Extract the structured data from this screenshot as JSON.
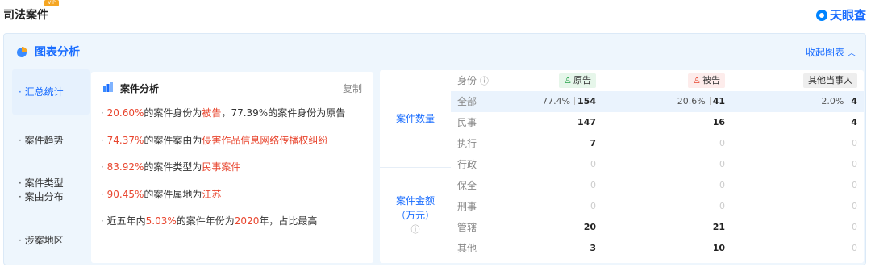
{
  "page": {
    "title": "司法案件",
    "badge": "VIP",
    "brand": "天眼查"
  },
  "panel": {
    "title": "图表分析",
    "collapse_label": "收起图表"
  },
  "nav": [
    {
      "label": "汇总统计"
    },
    {
      "label": "案件趋势"
    },
    {
      "label": "案件类型"
    },
    {
      "label": "案由分布"
    },
    {
      "label": "涉案地区"
    }
  ],
  "analysis": {
    "title": "案件分析",
    "copy_label": "复制",
    "lines": [
      {
        "a": "20.60%",
        "b": "的案件身份为",
        "c": "被告",
        "d": "，77.39%的案件身份为原告"
      },
      {
        "a": "74.37%",
        "b": "的案件案由为",
        "c": "侵害作品信息网络传播权纠纷",
        "d": ""
      },
      {
        "a": "83.92%",
        "b": "的案件类型为",
        "c": "民事案件",
        "d": ""
      },
      {
        "a": "90.45%",
        "b": "的案件属地为",
        "c": "江苏",
        "d": ""
      },
      {
        "pre": "近五年内",
        "a": "5.03%",
        "b": "的案件年份为",
        "c": "2020",
        "d": "年，占比最高"
      }
    ]
  },
  "stats": {
    "row_group_1": "案件数量",
    "row_group_2_line1": "案件金额",
    "row_group_2_line2": "（万元）",
    "header": {
      "label": "身份",
      "plaintiff": "原告",
      "defendant": "被告",
      "other": "其他当事人"
    },
    "rows": [
      {
        "label": "全部",
        "plaintiff_pct": "77.4%",
        "plaintiff": "154",
        "defendant_pct": "20.6%",
        "defendant": "41",
        "other_pct": "2.0%",
        "other": "4"
      },
      {
        "label": "民事",
        "plaintiff": "147",
        "defendant": "16",
        "other": "4"
      },
      {
        "label": "执行",
        "plaintiff": "7",
        "defendant": "0",
        "other": "0"
      },
      {
        "label": "行政",
        "plaintiff": "0",
        "defendant": "0",
        "other": "0"
      },
      {
        "label": "保全",
        "plaintiff": "0",
        "defendant": "0",
        "other": "0"
      },
      {
        "label": "刑事",
        "plaintiff": "0",
        "defendant": "0",
        "other": "0"
      },
      {
        "label": "管辖",
        "plaintiff": "20",
        "defendant": "21",
        "other": "0"
      },
      {
        "label": "其他",
        "plaintiff": "3",
        "defendant": "10",
        "other": "0"
      }
    ]
  },
  "colors": {
    "accent": "#1a6dff",
    "highlight": "#e8452e",
    "panel_bg": "#eef6fd"
  }
}
